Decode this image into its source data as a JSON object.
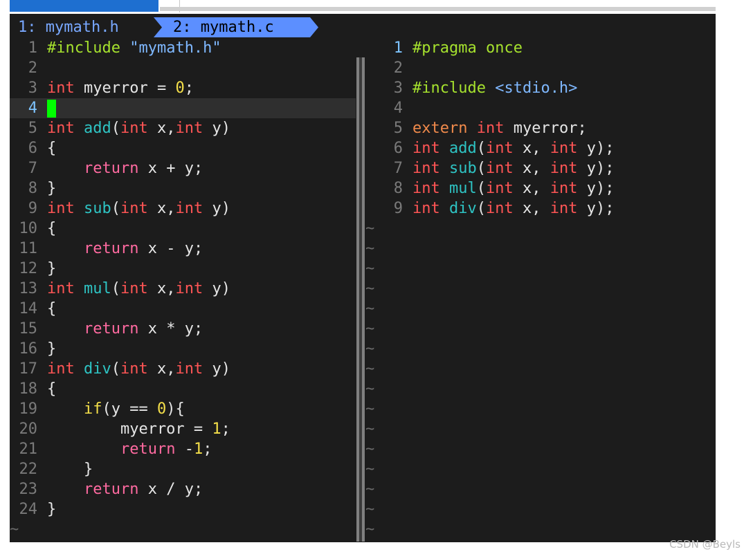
{
  "tabs": [
    {
      "label": "1: mymath.h",
      "active": false
    },
    {
      "label": "2: mymath.c",
      "active": true
    }
  ],
  "left_pane": {
    "lines": [
      {
        "num": "1",
        "tokens": [
          [
            "pp",
            "#include "
          ],
          [
            "str",
            "\"mymath.h\""
          ]
        ]
      },
      {
        "num": "2",
        "tokens": []
      },
      {
        "num": "3",
        "tokens": [
          [
            "kw",
            "int"
          ],
          [
            "plain",
            " myerror = "
          ],
          [
            "num",
            "0"
          ],
          [
            "plain",
            ";"
          ]
        ]
      },
      {
        "num": "4",
        "tokens": [],
        "current": true,
        "cursor": true
      },
      {
        "num": "5",
        "tokens": [
          [
            "kw",
            "int"
          ],
          [
            "plain",
            " "
          ],
          [
            "fn",
            "add"
          ],
          [
            "plain",
            "("
          ],
          [
            "kw",
            "int"
          ],
          [
            "plain",
            " x,"
          ],
          [
            "kw",
            "int"
          ],
          [
            "plain",
            " y)"
          ]
        ]
      },
      {
        "num": "6",
        "tokens": [
          [
            "plain",
            "{"
          ]
        ]
      },
      {
        "num": "7",
        "tokens": [
          [
            "plain",
            "    "
          ],
          [
            "ret",
            "return"
          ],
          [
            "plain",
            " x + y;"
          ]
        ]
      },
      {
        "num": "8",
        "tokens": [
          [
            "plain",
            "}"
          ]
        ]
      },
      {
        "num": "9",
        "tokens": [
          [
            "kw",
            "int"
          ],
          [
            "plain",
            " "
          ],
          [
            "fn",
            "sub"
          ],
          [
            "plain",
            "("
          ],
          [
            "kw",
            "int"
          ],
          [
            "plain",
            " x,"
          ],
          [
            "kw",
            "int"
          ],
          [
            "plain",
            " y)"
          ]
        ]
      },
      {
        "num": "10",
        "tokens": [
          [
            "plain",
            "{"
          ]
        ]
      },
      {
        "num": "11",
        "tokens": [
          [
            "plain",
            "    "
          ],
          [
            "ret",
            "return"
          ],
          [
            "plain",
            " x - y;"
          ]
        ]
      },
      {
        "num": "12",
        "tokens": [
          [
            "plain",
            "}"
          ]
        ]
      },
      {
        "num": "13",
        "tokens": [
          [
            "kw",
            "int"
          ],
          [
            "plain",
            " "
          ],
          [
            "fn",
            "mul"
          ],
          [
            "plain",
            "("
          ],
          [
            "kw",
            "int"
          ],
          [
            "plain",
            " x,"
          ],
          [
            "kw",
            "int"
          ],
          [
            "plain",
            " y)"
          ]
        ]
      },
      {
        "num": "14",
        "tokens": [
          [
            "plain",
            "{"
          ]
        ]
      },
      {
        "num": "15",
        "tokens": [
          [
            "plain",
            "    "
          ],
          [
            "ret",
            "return"
          ],
          [
            "plain",
            " x * y;"
          ]
        ]
      },
      {
        "num": "16",
        "tokens": [
          [
            "plain",
            "}"
          ]
        ]
      },
      {
        "num": "17",
        "tokens": [
          [
            "kw",
            "int"
          ],
          [
            "plain",
            " "
          ],
          [
            "fn",
            "div"
          ],
          [
            "plain",
            "("
          ],
          [
            "kw",
            "int"
          ],
          [
            "plain",
            " x,"
          ],
          [
            "kw",
            "int"
          ],
          [
            "plain",
            " y)"
          ]
        ]
      },
      {
        "num": "18",
        "tokens": [
          [
            "plain",
            "{"
          ]
        ]
      },
      {
        "num": "19",
        "tokens": [
          [
            "plain",
            "    "
          ],
          [
            "ifk",
            "if"
          ],
          [
            "plain",
            "(y == "
          ],
          [
            "num",
            "0"
          ],
          [
            "plain",
            "){"
          ]
        ]
      },
      {
        "num": "20",
        "tokens": [
          [
            "plain",
            "        myerror = "
          ],
          [
            "num",
            "1"
          ],
          [
            "plain",
            ";"
          ]
        ]
      },
      {
        "num": "21",
        "tokens": [
          [
            "plain",
            "        "
          ],
          [
            "ret",
            "return"
          ],
          [
            "plain",
            " -"
          ],
          [
            "num",
            "1"
          ],
          [
            "plain",
            ";"
          ]
        ]
      },
      {
        "num": "22",
        "tokens": [
          [
            "plain",
            "    }"
          ]
        ]
      },
      {
        "num": "23",
        "tokens": [
          [
            "plain",
            "    "
          ],
          [
            "ret",
            "return"
          ],
          [
            "plain",
            " x / y;"
          ]
        ]
      },
      {
        "num": "24",
        "tokens": [
          [
            "plain",
            "}"
          ]
        ]
      }
    ],
    "filler": "~"
  },
  "right_pane": {
    "lines": [
      {
        "num": "1",
        "current": true,
        "tokens": [
          [
            "pp",
            "#pragma once"
          ]
        ]
      },
      {
        "num": "2",
        "tokens": []
      },
      {
        "num": "3",
        "tokens": [
          [
            "pp",
            "#include "
          ],
          [
            "str",
            "<stdio.h>"
          ]
        ]
      },
      {
        "num": "4",
        "tokens": []
      },
      {
        "num": "5",
        "tokens": [
          [
            "ext",
            "extern"
          ],
          [
            "plain",
            " "
          ],
          [
            "kw",
            "int"
          ],
          [
            "plain",
            " myerror;"
          ]
        ]
      },
      {
        "num": "6",
        "tokens": [
          [
            "kw",
            "int"
          ],
          [
            "plain",
            " "
          ],
          [
            "fn",
            "add"
          ],
          [
            "plain",
            "("
          ],
          [
            "kw",
            "int"
          ],
          [
            "plain",
            " x, "
          ],
          [
            "kw",
            "int"
          ],
          [
            "plain",
            " y);"
          ]
        ]
      },
      {
        "num": "7",
        "tokens": [
          [
            "kw",
            "int"
          ],
          [
            "plain",
            " "
          ],
          [
            "fn",
            "sub"
          ],
          [
            "plain",
            "("
          ],
          [
            "kw",
            "int"
          ],
          [
            "plain",
            " x, "
          ],
          [
            "kw",
            "int"
          ],
          [
            "plain",
            " y);"
          ]
        ]
      },
      {
        "num": "8",
        "tokens": [
          [
            "kw",
            "int"
          ],
          [
            "plain",
            " "
          ],
          [
            "fn",
            "mul"
          ],
          [
            "plain",
            "("
          ],
          [
            "kw",
            "int"
          ],
          [
            "plain",
            " x, "
          ],
          [
            "kw",
            "int"
          ],
          [
            "plain",
            " y);"
          ]
        ]
      },
      {
        "num": "9",
        "tokens": [
          [
            "kw",
            "int"
          ],
          [
            "plain",
            " "
          ],
          [
            "fn",
            "div"
          ],
          [
            "plain",
            "("
          ],
          [
            "kw",
            "int"
          ],
          [
            "plain",
            " x, "
          ],
          [
            "kw",
            "int"
          ],
          [
            "plain",
            " y);"
          ]
        ]
      }
    ],
    "filler": "~",
    "filler_rows": 16
  },
  "watermark": "CSDN @Beyls"
}
